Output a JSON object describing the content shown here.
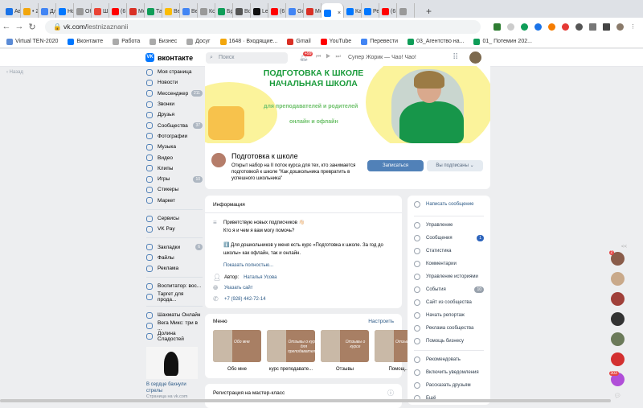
{
  "browser": {
    "tabs": [
      {
        "label": "Ав",
        "color": "#1a73e8"
      },
      {
        "label": "• 2",
        "color": "#f2a60c"
      },
      {
        "label": "Дл",
        "color": "#4285f4"
      },
      {
        "label": "Но",
        "color": "#0077ff"
      },
      {
        "label": "Об",
        "color": "#999999"
      },
      {
        "label": "Ш",
        "color": "#ea4335"
      },
      {
        "label": "(6",
        "color": "#ff0000"
      },
      {
        "label": "Ме",
        "color": "#d93025"
      },
      {
        "label": "Та",
        "color": "#0f9d58"
      },
      {
        "label": "Ве",
        "color": "#fbbc04"
      },
      {
        "label": "Ве",
        "color": "#4285f4"
      },
      {
        "label": "Ко",
        "color": "#999999"
      },
      {
        "label": "Бр",
        "color": "#0f9d58"
      },
      {
        "label": "Во",
        "color": "#555555"
      },
      {
        "label": "Le",
        "color": "#111111"
      },
      {
        "label": "(6",
        "color": "#ff0000"
      },
      {
        "label": "Go",
        "color": "#4285f4"
      },
      {
        "label": "Ме",
        "color": "#d93025"
      },
      {
        "label": "",
        "color": "#0077ff",
        "active": true
      },
      {
        "label": "Ка",
        "color": "#0077ff"
      },
      {
        "label": "Ре",
        "color": "#0077ff"
      },
      {
        "label": "(6",
        "color": "#ff0000"
      },
      {
        "label": "",
        "color": "#999999"
      }
    ],
    "new_tab": "+",
    "url_host": "vk.com/",
    "url_path": "lestnizaznanii",
    "bookmarks": [
      {
        "label": "Virtual TEN-2020",
        "color": "#5b8bd6"
      },
      {
        "label": "Вконтакте",
        "color": "#0077ff"
      },
      {
        "label": "Работа",
        "color": "#aaaaaa"
      },
      {
        "label": "Бизнес",
        "color": "#aaaaaa"
      },
      {
        "label": "Досуг",
        "color": "#aaaaaa"
      },
      {
        "label": "1648 · Входящие...",
        "color": "#f2a60c"
      },
      {
        "label": "Gmail",
        "color": "#d93025"
      },
      {
        "label": "YouTube",
        "color": "#ff0000"
      },
      {
        "label": "Перевести",
        "color": "#4285f4"
      },
      {
        "label": "03_Агентство на...",
        "color": "#0f9d58"
      },
      {
        "label": "01_ Потемин 202...",
        "color": "#0f9d58"
      }
    ]
  },
  "vk_header": {
    "logo": "вконтакте",
    "search_placeholder": "Поиск",
    "notif_badge": "+99",
    "track": "Супер Жорик — Чао! Чао!"
  },
  "back": "Назад",
  "left_nav": {
    "main": [
      {
        "label": "Моя страница"
      },
      {
        "label": "Новости"
      },
      {
        "label": "Мессенджер",
        "count": "211"
      },
      {
        "label": "Звонки"
      },
      {
        "label": "Друзья"
      },
      {
        "label": "Сообщества",
        "count": "37"
      },
      {
        "label": "Фотографии"
      },
      {
        "label": "Музыка"
      },
      {
        "label": "Видео"
      },
      {
        "label": "Клипы"
      },
      {
        "label": "Игры",
        "count": "10"
      },
      {
        "label": "Стикеры"
      },
      {
        "label": "Маркет"
      }
    ],
    "services": [
      {
        "label": "Сервисы"
      },
      {
        "label": "VK Pay"
      }
    ],
    "saved": [
      {
        "label": "Закладки",
        "count": "6"
      },
      {
        "label": "Файлы"
      },
      {
        "label": "Реклама"
      }
    ],
    "groups": [
      {
        "label": "Воспитатор: вос..."
      },
      {
        "label": "Таргет для прода..."
      }
    ],
    "apps": [
      {
        "label": "Шахматы Онлайн"
      },
      {
        "label": "Вега Микс: три в ..."
      },
      {
        "label": "Долина Сладостей"
      }
    ],
    "promo": {
      "title": "В сердце бахнули стрелы",
      "subtitle": "Страница на vk.com"
    }
  },
  "cover": {
    "line1": "ПОДГОТОВКА К ШКОЛЕ",
    "line2": "НАЧАЛЬНАЯ ШКОЛА",
    "line3": "для преподавателей и родителей",
    "line4": "онлайн и офлайн"
  },
  "group": {
    "name": "Подготовка к школе",
    "description": "Открыт набор на II поток курса для тех, кто занимается подготовкой к школе \"Как дошкольника превратить в успешного школьника\"",
    "join": "Записаться",
    "subscribed": "Вы подписаны"
  },
  "info": {
    "title": "Информация",
    "line1": "Приветствую новых подписчиков 👋🏻",
    "line2": "Кто я и чем я вам могу помочь?",
    "line3": "ℹ️ Для дошкольников у меня есть курс «Подготовка к школе. За год до школы» как офлайн, так и онлайн.",
    "more": "Показать полностью...",
    "author_label": "Автор:",
    "author": "Наталья Усова",
    "site": "Указать сайт",
    "phone": "+7 (928) 442-72-14"
  },
  "menu": {
    "title": "Меню",
    "configure": "Настроить",
    "items": [
      {
        "label": "Обо мне",
        "img": "Обо мне"
      },
      {
        "label": "курс преподавате...",
        "img": "Отзывы о курсе для преподавателей"
      },
      {
        "label": "Отзывы",
        "img": "Отзывы о курсе"
      },
      {
        "label": "Помощ...",
        "img": "Отзывы"
      }
    ]
  },
  "registration": {
    "title": "Регистрация на мастер-класс"
  },
  "right_menu": {
    "write": "Написать сообщение",
    "admin": [
      {
        "label": "Управление"
      },
      {
        "label": "Сообщения",
        "count": "1",
        "color": "#2d64bc"
      },
      {
        "label": "Статистика"
      },
      {
        "label": "Комментарии"
      },
      {
        "label": "Управление историями"
      },
      {
        "label": "События",
        "count": "10",
        "color": "#99a2ad"
      },
      {
        "label": "Сайт из сообщества"
      },
      {
        "label": "Начать репортаж"
      },
      {
        "label": "Реклама сообщества"
      },
      {
        "label": "Помощь бизнесу"
      }
    ],
    "social": [
      {
        "label": "Рекомендовать"
      },
      {
        "label": "Включить уведомления"
      },
      {
        "label": "Рассказать друзьям"
      },
      {
        "label": "Ещё"
      }
    ]
  },
  "chats": {
    "collapse": "<<",
    "items": [
      {
        "badge": "2",
        "color": "#8a5c4a"
      },
      {
        "color": "#c9a98a"
      },
      {
        "color": "#a0403a"
      },
      {
        "color": "#333333"
      },
      {
        "color": "#6b7a5a"
      },
      {
        "color": "#d33030"
      },
      {
        "badge": "303",
        "color": "#b04ed8"
      }
    ]
  }
}
